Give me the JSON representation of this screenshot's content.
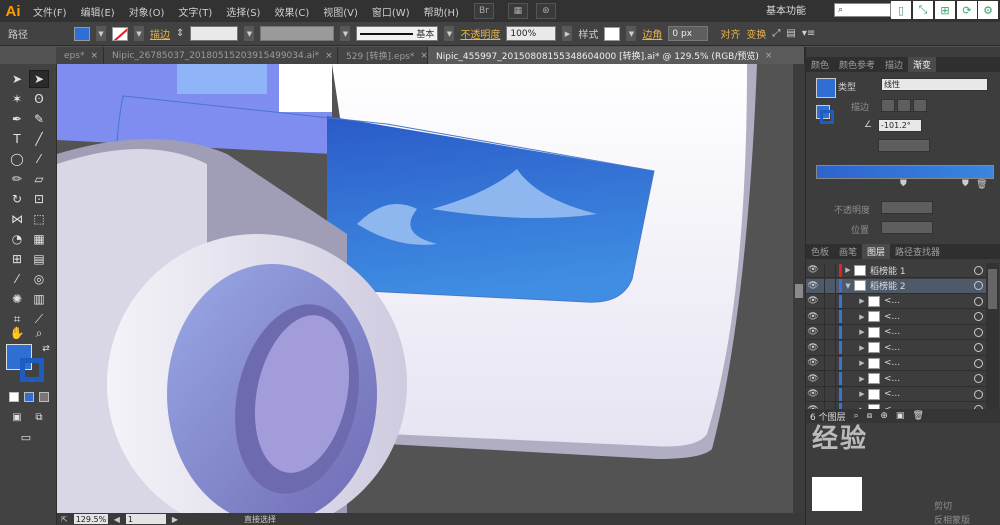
{
  "app": {
    "logo": "Ai",
    "workspace": "基本功能"
  },
  "menu": [
    "文件(F)",
    "编辑(E)",
    "对象(O)",
    "文字(T)",
    "选择(S)",
    "效果(C)",
    "视图(V)",
    "窗口(W)",
    "帮助(H)"
  ],
  "menu_icons": [
    "Br",
    "▦",
    "⊛"
  ],
  "window_buttons": [
    "▯",
    "⤡",
    "⊞",
    "⟳",
    "⚙"
  ],
  "control": {
    "object_type": "路径",
    "stroke_label": "描边",
    "stroke_arrows": "⇕",
    "brush_label": "基本",
    "opacity_label": "不透明度",
    "opacity_value": "100%",
    "style_label": "样式",
    "corner_label": "边角",
    "corner_value": "0 px",
    "align_label": "对齐",
    "transform_label": "变换",
    "fill_color": "#2f6fd3"
  },
  "tabs": [
    {
      "label": "eps*",
      "close": "×"
    },
    {
      "label": "Nipic_26785037_20180515203915499034.ai*",
      "close": "×"
    },
    {
      "label": "529 [转换].eps*",
      "close": "×"
    },
    {
      "label": "Nipic_455997_20150808155348604000 [转换].ai* @ 129.5% (RGB/预览)",
      "close": "×"
    }
  ],
  "status": {
    "zoom": "129.5%",
    "page": "1",
    "tool_name": "直接选择"
  },
  "gradient_panel": {
    "tabs": [
      "颜色",
      "颜色参考",
      "描边",
      "渐变"
    ],
    "type_label": "类型",
    "type_value": "线性",
    "stroke_label": "描边",
    "angle_value": "-101.2°",
    "opacity_label": "不透明度",
    "position_label": "位置",
    "stop_left_color": "#2d63cc",
    "stop_right_color": "#3a86e0"
  },
  "layers_panel": {
    "tabs": [
      "色板",
      "画笔",
      "图层",
      "路径查找器"
    ],
    "rows": [
      {
        "name": "稻榜能 1",
        "level": 0,
        "color": "#e02424",
        "selected": false
      },
      {
        "name": "稻榜能 2",
        "level": 0,
        "color": "#3a72d6",
        "selected": true
      },
      {
        "name": "<...",
        "level": 1,
        "color": "#3a72d6",
        "selected": false
      },
      {
        "name": "<...",
        "level": 1,
        "color": "#3a72d6",
        "selected": false
      },
      {
        "name": "<...",
        "level": 1,
        "color": "#3a72d6",
        "selected": false
      },
      {
        "name": "<...",
        "level": 1,
        "color": "#3a72d6",
        "selected": false
      },
      {
        "name": "<...",
        "level": 1,
        "color": "#3a72d6",
        "selected": false
      },
      {
        "name": "<...",
        "level": 1,
        "color": "#3a72d6",
        "selected": false
      },
      {
        "name": "<...",
        "level": 1,
        "color": "#3a72d6",
        "selected": false
      },
      {
        "name": "<...",
        "level": 1,
        "color": "#3a72d6",
        "selected": false
      }
    ],
    "count_label": "6 个图层"
  },
  "bottom_panel": {
    "label1": "剪切",
    "label2": "反相蒙版"
  },
  "watermark": "经验"
}
